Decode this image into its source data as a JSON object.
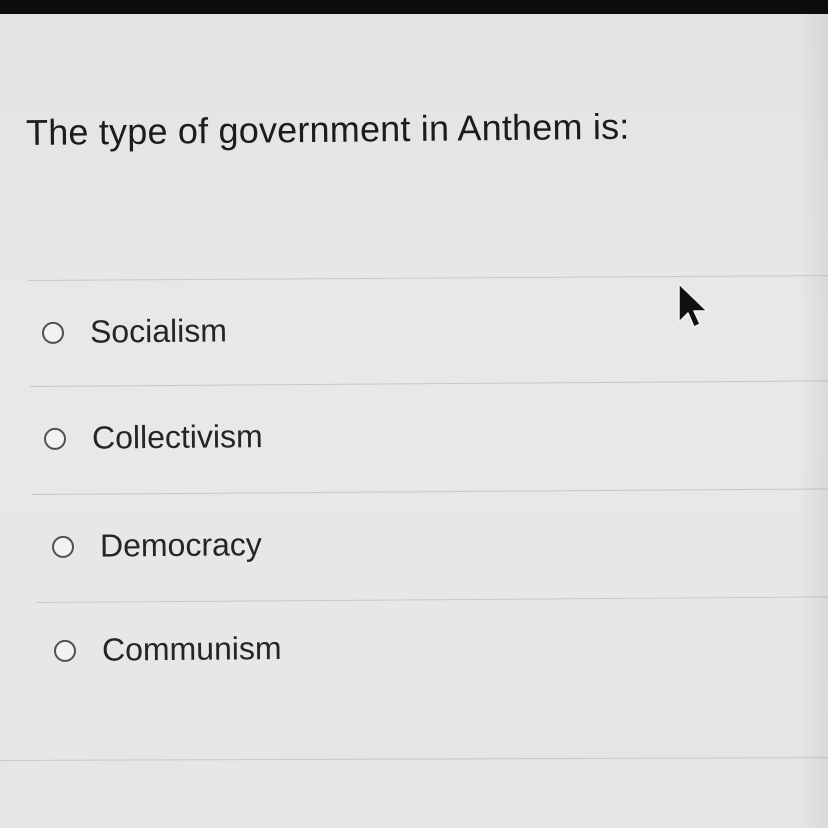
{
  "quiz": {
    "question": "The type of government in Anthem is:",
    "options": [
      {
        "label": "Socialism",
        "selected": false
      },
      {
        "label": "Collectivism",
        "selected": false
      },
      {
        "label": "Democracy",
        "selected": false
      },
      {
        "label": "Communism",
        "selected": false
      }
    ]
  },
  "icons": {
    "cursor": "mouse-pointer-arrow",
    "option_marker": "radio-button-empty"
  }
}
